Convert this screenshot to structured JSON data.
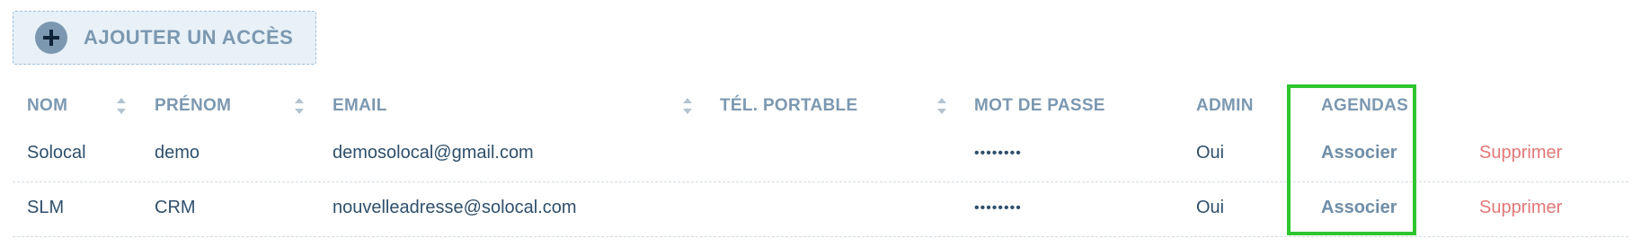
{
  "add_button": {
    "label": "AJOUTER UN ACCÈS",
    "icon": "plus-circle-icon"
  },
  "table": {
    "columns": [
      {
        "key": "nom",
        "label": "NOM",
        "sortable": true
      },
      {
        "key": "prenom",
        "label": "PRÉNOM",
        "sortable": true
      },
      {
        "key": "email",
        "label": "EMAIL",
        "sortable": true
      },
      {
        "key": "tel",
        "label": "TÉL. PORTABLE",
        "sortable": true
      },
      {
        "key": "password",
        "label": "MOT DE PASSE",
        "sortable": false
      },
      {
        "key": "admin",
        "label": "ADMIN",
        "sortable": false
      },
      {
        "key": "agendas",
        "label": "AGENDAS",
        "sortable": false
      }
    ],
    "rows": [
      {
        "nom": "Solocal",
        "prenom": "demo",
        "email": "demosolocal@gmail.com",
        "tel": "",
        "password": "••••••••",
        "admin": "Oui",
        "agendas_action": "Associer",
        "delete_action": "Supprimer"
      },
      {
        "nom": "SLM",
        "prenom": "CRM",
        "email": "nouvelleadresse@solocal.com",
        "tel": "",
        "password": "••••••••",
        "admin": "Oui",
        "agendas_action": "Associer",
        "delete_action": "Supprimer"
      }
    ]
  },
  "colors": {
    "header_text": "#7c98b0",
    "body_text": "#2f4f6b",
    "delete_link": "#e27777",
    "highlight_border": "#2ec52e",
    "add_button_bg": "#e8f1f7"
  }
}
